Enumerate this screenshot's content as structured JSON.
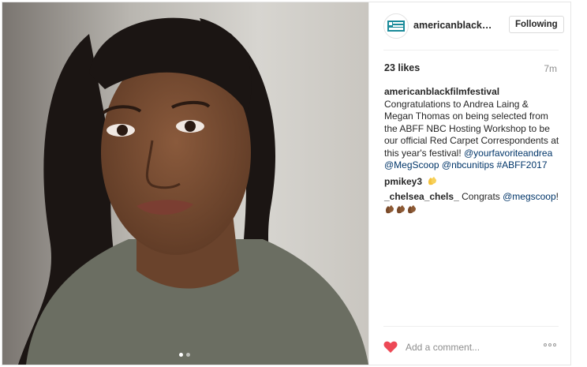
{
  "post": {
    "username": "americanblackfilmfestival",
    "username_short": "americanblackfilm...",
    "follow_label": "Following",
    "avatar_logo_text": "AMERICAN BLACK FILM",
    "likes": "23 likes",
    "time": "7m",
    "caption_user": "americanblackfilmfestival",
    "caption_text": " Congratulations to Andrea Laing & Megan Thomas on being selected from the ABFF NBC Hosting Workshop to be our official Red Carpet Correspondents at this year's festival! ",
    "caption_links": [
      "@yourfavoriteandrea",
      "@MegScoop",
      "@nbcunitips",
      "#ABFF2017"
    ],
    "comments": [
      {
        "user": "pmikey3",
        "text": "",
        "emoji": "clapping-hands"
      },
      {
        "user": "_chelsea_chels_",
        "text": " Congrats ",
        "link": "@megscoop",
        "tail": "!",
        "emoji": "clapping-hands-x3"
      }
    ],
    "add_comment_placeholder": "Add a comment...",
    "carousel": {
      "count": 2,
      "active": 0
    }
  },
  "colors": {
    "link": "#003569",
    "heart": "#ed4956",
    "muted": "#8e8e8e",
    "text": "#262626"
  }
}
